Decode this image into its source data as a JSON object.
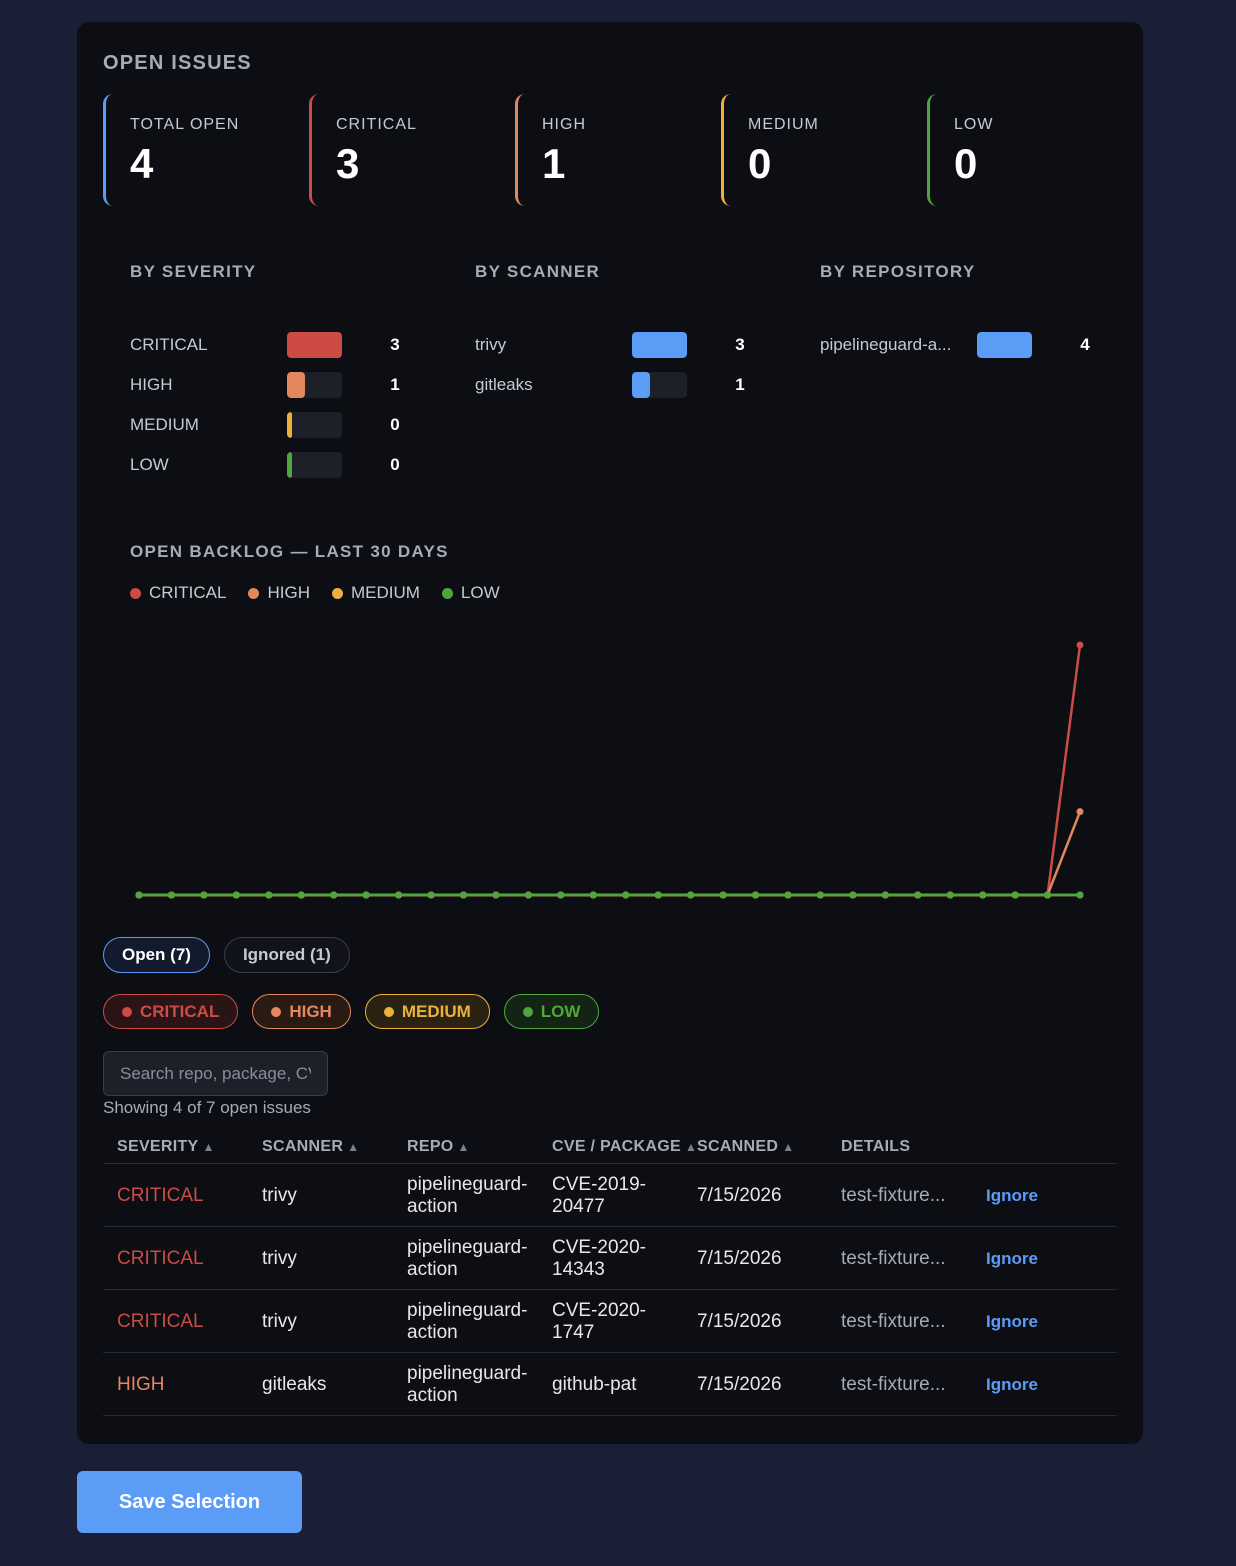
{
  "colors": {
    "critical": "#cc4b45",
    "high": "#e3875f",
    "medium": "#eab23a",
    "low": "#4ea63c",
    "accent": "#5b9cf7"
  },
  "card": {
    "title": "OPEN ISSUES",
    "stats": [
      {
        "label": "TOTAL OPEN",
        "value": "4",
        "color": "#5b9cf7"
      },
      {
        "label": "CRITICAL",
        "value": "3",
        "color": "#cc4b45"
      },
      {
        "label": "HIGH",
        "value": "1",
        "color": "#e3875f"
      },
      {
        "label": "MEDIUM",
        "value": "0",
        "color": "#eab23a"
      },
      {
        "label": "LOW",
        "value": "0",
        "color": "#4ea63c"
      }
    ]
  },
  "breakdowns": {
    "severity": {
      "title": "BY SEVERITY",
      "rows": [
        {
          "label": "CRITICAL",
          "count": "3",
          "fraction": 1.0,
          "color": "#cc4b45"
        },
        {
          "label": "HIGH",
          "count": "1",
          "fraction": 0.333,
          "color": "#e3875f"
        },
        {
          "label": "MEDIUM",
          "count": "0",
          "fraction": 0.0,
          "color": "#eab23a"
        },
        {
          "label": "LOW",
          "count": "0",
          "fraction": 0.0,
          "color": "#4ea63c"
        }
      ]
    },
    "scanner": {
      "title": "BY SCANNER",
      "rows": [
        {
          "label": "trivy",
          "count": "3",
          "fraction": 1.0,
          "color": "#5b9cf7"
        },
        {
          "label": "gitleaks",
          "count": "1",
          "fraction": 0.333,
          "color": "#5b9cf7"
        }
      ]
    },
    "repository": {
      "title": "BY REPOSITORY",
      "rows": [
        {
          "label": "pipelineguard-a...",
          "count": "4",
          "fraction": 1.0,
          "color": "#5b9cf7"
        }
      ]
    }
  },
  "backlog": {
    "title": "OPEN BACKLOG — LAST 30 DAYS",
    "legend": [
      "CRITICAL",
      "HIGH",
      "MEDIUM",
      "LOW"
    ]
  },
  "chart_data": {
    "type": "line",
    "title": "OPEN BACKLOG — LAST 30 DAYS",
    "x": [
      1,
      2,
      3,
      4,
      5,
      6,
      7,
      8,
      9,
      10,
      11,
      12,
      13,
      14,
      15,
      16,
      17,
      18,
      19,
      20,
      21,
      22,
      23,
      24,
      25,
      26,
      27,
      28,
      29,
      30
    ],
    "ylim": [
      0,
      3
    ],
    "grid": false,
    "legend_position": "top-left",
    "series": [
      {
        "name": "CRITICAL",
        "color": "#cc4b45",
        "values": [
          0,
          0,
          0,
          0,
          0,
          0,
          0,
          0,
          0,
          0,
          0,
          0,
          0,
          0,
          0,
          0,
          0,
          0,
          0,
          0,
          0,
          0,
          0,
          0,
          0,
          0,
          0,
          0,
          0,
          3
        ]
      },
      {
        "name": "HIGH",
        "color": "#e3875f",
        "values": [
          0,
          0,
          0,
          0,
          0,
          0,
          0,
          0,
          0,
          0,
          0,
          0,
          0,
          0,
          0,
          0,
          0,
          0,
          0,
          0,
          0,
          0,
          0,
          0,
          0,
          0,
          0,
          0,
          0,
          1
        ]
      },
      {
        "name": "MEDIUM",
        "color": "#eab23a",
        "values": [
          0,
          0,
          0,
          0,
          0,
          0,
          0,
          0,
          0,
          0,
          0,
          0,
          0,
          0,
          0,
          0,
          0,
          0,
          0,
          0,
          0,
          0,
          0,
          0,
          0,
          0,
          0,
          0,
          0,
          0
        ]
      },
      {
        "name": "LOW",
        "color": "#4ea63c",
        "values": [
          0,
          0,
          0,
          0,
          0,
          0,
          0,
          0,
          0,
          0,
          0,
          0,
          0,
          0,
          0,
          0,
          0,
          0,
          0,
          0,
          0,
          0,
          0,
          0,
          0,
          0,
          0,
          0,
          0,
          0
        ]
      }
    ]
  },
  "tabs": [
    {
      "label": "Open (7)",
      "active": true
    },
    {
      "label": "Ignored (1)",
      "active": false
    }
  ],
  "filter_chips": [
    {
      "label": "CRITICAL",
      "color": "#cc4b45",
      "bg": "#2a1416"
    },
    {
      "label": "HIGH",
      "color": "#e3875f",
      "bg": "#2a1a14"
    },
    {
      "label": "MEDIUM",
      "color": "#eab23a",
      "bg": "#2a2212"
    },
    {
      "label": "LOW",
      "color": "#4ea63c",
      "bg": "#142414"
    }
  ],
  "search": {
    "placeholder": "Search repo, package, CVE..."
  },
  "showing_text": "Showing 4 of 7 open issues",
  "table": {
    "columns": [
      "SEVERITY",
      "SCANNER",
      "REPO",
      "CVE / PACKAGE",
      "SCANNED",
      "DETAILS"
    ],
    "sortable": [
      true,
      true,
      true,
      true,
      true,
      false
    ],
    "sort_arrow": "▲",
    "rows": [
      {
        "severity": "CRITICAL",
        "sev_color": "#cc4b45",
        "scanner": "trivy",
        "repo": "pipelineguard-action",
        "cve": "CVE-2019-20477",
        "scanned": "7/15/2026",
        "details": "test-fixture...",
        "action": "Ignore"
      },
      {
        "severity": "CRITICAL",
        "sev_color": "#cc4b45",
        "scanner": "trivy",
        "repo": "pipelineguard-action",
        "cve": "CVE-2020-14343",
        "scanned": "7/15/2026",
        "details": "test-fixture...",
        "action": "Ignore"
      },
      {
        "severity": "CRITICAL",
        "sev_color": "#cc4b45",
        "scanner": "trivy",
        "repo": "pipelineguard-action",
        "cve": "CVE-2020-1747",
        "scanned": "7/15/2026",
        "details": "test-fixture...",
        "action": "Ignore"
      },
      {
        "severity": "HIGH",
        "sev_color": "#e3875f",
        "scanner": "gitleaks",
        "repo": "pipelineguard-action",
        "cve": "github-pat",
        "scanned": "7/15/2026",
        "details": "test-fixture...",
        "action": "Ignore"
      }
    ]
  },
  "save_button": {
    "label": "Save Selection"
  }
}
